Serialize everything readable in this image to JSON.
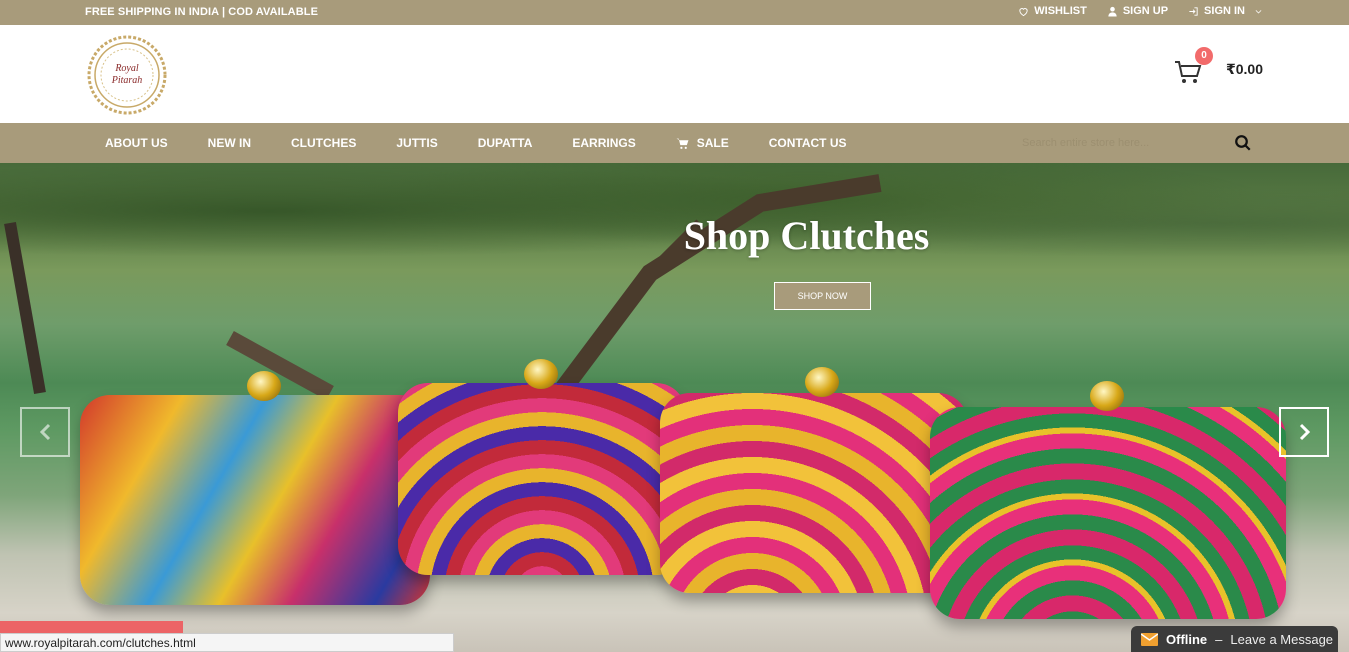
{
  "topbar": {
    "promo": "FREE SHIPPING IN INDIA | COD AVAILABLE",
    "wishlist": "WISHLIST",
    "signup": "SIGN UP",
    "signin": "SIGN IN"
  },
  "header": {
    "logo_line1": "Royal",
    "logo_line2": "Pitarah",
    "cart_count": "0",
    "cart_total": "₹0.00"
  },
  "nav": {
    "items": [
      "ABOUT US",
      "NEW IN",
      "CLUTCHES",
      "JUTTIS",
      "DUPATTA",
      "EARRINGS",
      "SALE",
      "CONTACT US"
    ],
    "search_placeholder": "Search entire store here..."
  },
  "hero": {
    "title": "Shop Clutches",
    "button": "SHOP NOW"
  },
  "status_url": "www.royalpitarah.com/clutches.html",
  "chat": {
    "status": "Offline",
    "message": "Leave a Message"
  },
  "colors": {
    "brand": "#a89b7b",
    "badge": "#f26b6b",
    "chat_bg": "#3b3b3b"
  },
  "icons": [
    "heart-icon",
    "user-icon",
    "sign-in-icon",
    "chevron-down-icon",
    "cart-icon",
    "shopping-cart-icon",
    "search-icon",
    "chevron-left-icon",
    "chevron-right-icon",
    "envelope-icon"
  ]
}
